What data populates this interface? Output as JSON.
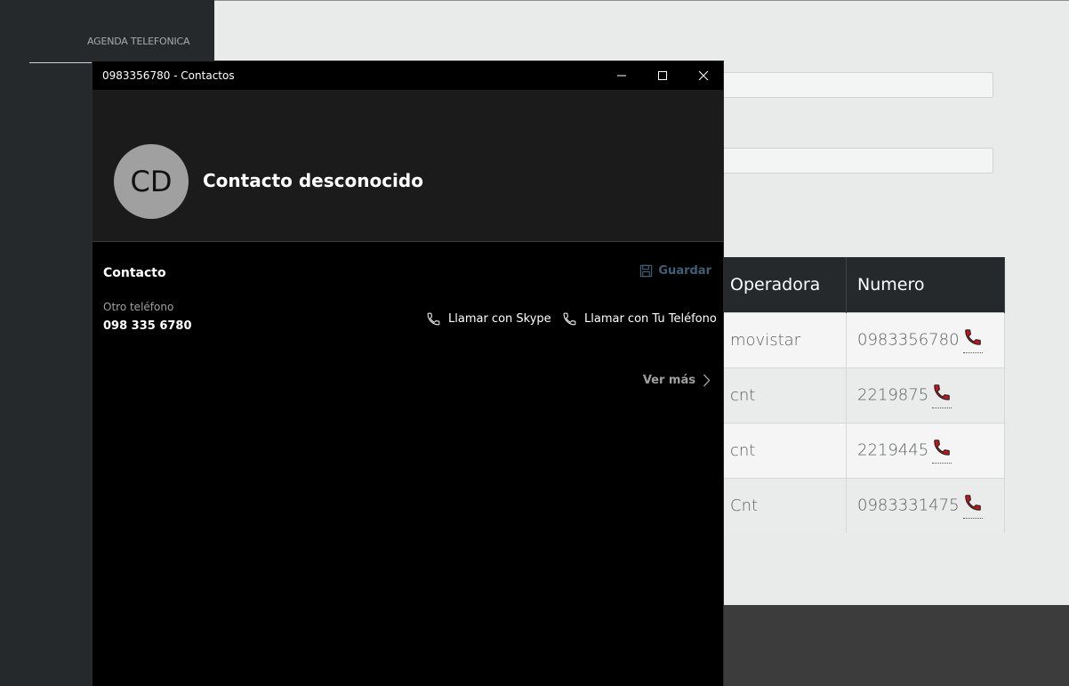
{
  "sidebar": {
    "title": "AGENDA TELEFONICA"
  },
  "table": {
    "headers": [
      "Operadora",
      "Numero"
    ],
    "rows": [
      {
        "operadora": "movistar",
        "numero": "0983356780"
      },
      {
        "operadora": "cnt",
        "numero": "2219875"
      },
      {
        "operadora": "cnt",
        "numero": "2219445"
      },
      {
        "operadora": "Cnt",
        "numero": "0983331475"
      }
    ]
  },
  "window": {
    "title": "0983356780 - Contactos",
    "avatar_initials": "CD",
    "contact_name": "Contacto desconocido",
    "section_title": "Contacto",
    "save_label": "Guardar",
    "phone_label": "Otro teléfono",
    "phone_value": "098 335 6780",
    "call_skype_label": "Llamar con Skype",
    "call_phone_label": "Llamar con Tu Teléfono",
    "see_more_label": "Ver más"
  },
  "colors": {
    "accent_save": "#3f5e75",
    "call_icon": "#c0151b"
  }
}
